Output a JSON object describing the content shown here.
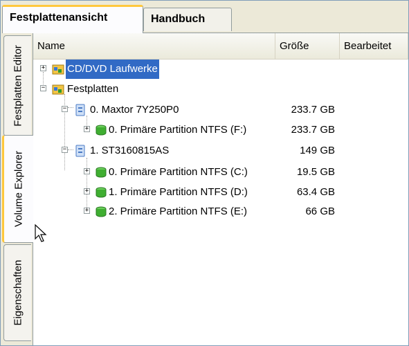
{
  "tabs": {
    "top": [
      "Festplattenansicht",
      "Handbuch"
    ],
    "side": [
      "Festplatten Editor",
      "Volume Explorer",
      "Eigenschaften"
    ]
  },
  "columns": [
    "Name",
    "Größe",
    "Bearbeitet"
  ],
  "tree": {
    "cd_dvd": "CD/DVD Laufwerke",
    "disks": "Festplatten",
    "disk0": {
      "name": "0. Maxtor 7Y250P0",
      "size": "233.7 GB"
    },
    "disk0_part0": {
      "name": "0. Primäre Partition NTFS (F:)",
      "size": "233.7 GB"
    },
    "disk1": {
      "name": "1. ST3160815AS",
      "size": "149 GB"
    },
    "disk1_part0": {
      "name": "0. Primäre Partition NTFS (C:)",
      "size": "19.5 GB"
    },
    "disk1_part1": {
      "name": "1. Primäre Partition NTFS (D:)",
      "size": "63.4 GB"
    },
    "disk1_part2": {
      "name": "2. Primäre Partition NTFS (E:)",
      "size": "66 GB"
    }
  },
  "expander_symbols": {
    "collapsed": "+",
    "expanded": "−"
  },
  "icons": {
    "folder": "folder-icon",
    "disk": "hard-disk-icon",
    "partition": "partition-disk-icon",
    "cursor": "mouse-cursor-icon"
  },
  "colors": {
    "selection": "#316ac5",
    "tab_highlight": "#ffc83c",
    "panel_bg": "#ece9d8"
  }
}
